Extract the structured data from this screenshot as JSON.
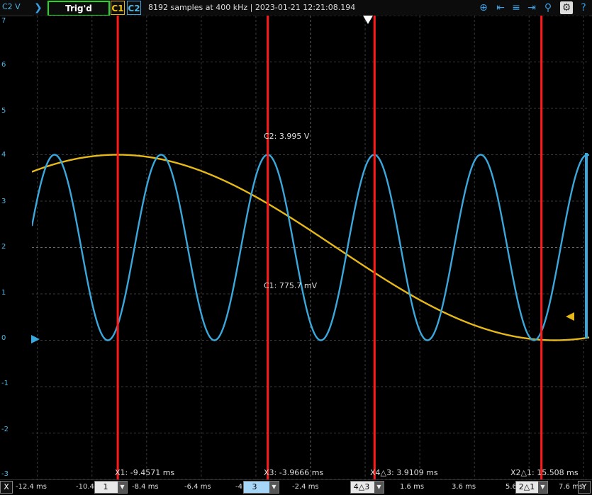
{
  "toolbar": {
    "channel_axis": "C2 V",
    "trigger_status": "Trig'd",
    "c1_label": "C1",
    "c2_label": "C2",
    "acquisition_info": "8192 samples at 400 kHz | 2023-01-21 12:21:08.194"
  },
  "y_ticks": [
    "7",
    "6",
    "5",
    "4",
    "3",
    "2",
    "1",
    "0",
    "-1",
    "-2",
    "-3"
  ],
  "x_ticks": [
    "-12.4 ms",
    "-10.4",
    "-8.4 ms",
    "-6.4 ms",
    "-4",
    "-2.4 ms",
    "1.6 ms",
    "3.6 ms",
    "5.6",
    "7.6 ms"
  ],
  "readouts": {
    "c2_value": "C2: 3.995 V",
    "c1_value": "C1: 775.7 mV"
  },
  "cursors": {
    "x1": "X1: -9.4571 ms",
    "x3": "X3: -3.9666 ms",
    "x4": "X4△3: 3.9109 ms",
    "x2": "X2△1: 15.508 ms"
  },
  "selectors": {
    "sel1": "1",
    "sel3": "3",
    "sel43": "4△3",
    "sel21": "2△1"
  },
  "bottom": {
    "x_label": "X",
    "y_label": "Y"
  },
  "colors": {
    "c1": "#e6b818",
    "c2": "#3aa8dc",
    "cursor": "#ff1a1a",
    "trigger": "#1ddc1d"
  },
  "chart_data": {
    "type": "line",
    "x_unit": "ms",
    "y_unit": "V",
    "ylim": [
      -3,
      7
    ],
    "xlim": [
      -12.6,
      7.8
    ],
    "grid": true,
    "series": [
      {
        "name": "C1",
        "type": "sine",
        "offset": 2.0,
        "amplitude": 2.0,
        "period_ms": 32,
        "peak_at_ms": -9.46
      },
      {
        "name": "C2",
        "type": "sine",
        "offset": 2.0,
        "amplitude": 2.0,
        "period_ms": 3.9,
        "peak_at_ms": -3.97
      }
    ],
    "cursors_ms": [
      -9.4571,
      -3.9666,
      -0.0557,
      6.0509
    ]
  }
}
